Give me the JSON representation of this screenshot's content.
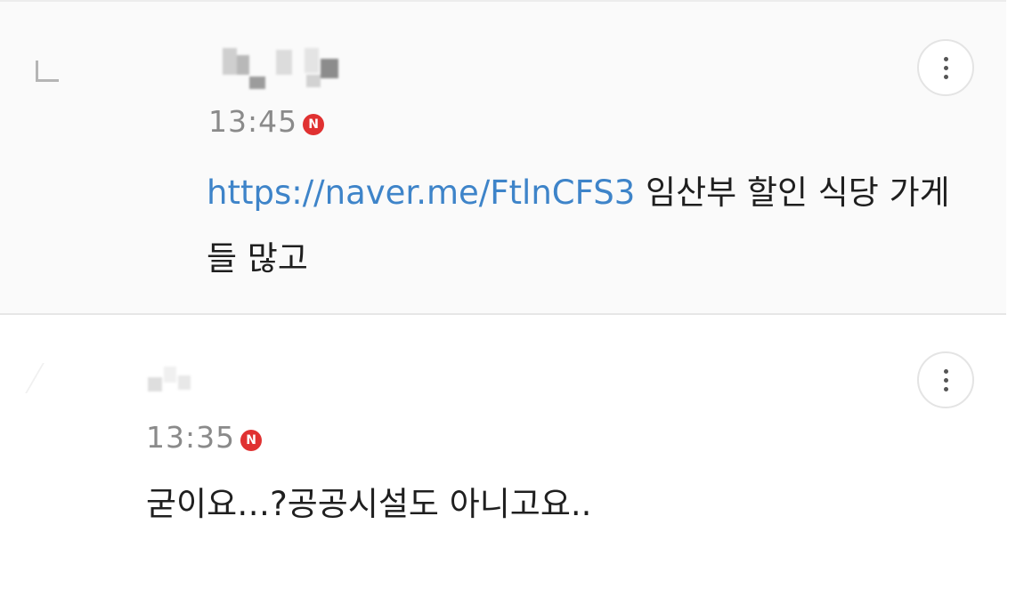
{
  "comments": [
    {
      "type": "reply",
      "time": "13:45",
      "badge": "N",
      "link": "https://naver.me/FtlnCFS3",
      "text_after_link": " 임산부 할인 식당 가게들 많고 "
    },
    {
      "type": "comment",
      "time": "13:35",
      "badge": "N",
      "text": "굳이요…?공공시설도 아니고요.."
    }
  ],
  "icons": {
    "reply_indicator": "reply-arrow-icon",
    "more": "more-vertical-icon"
  },
  "colors": {
    "link": "#3e84c9",
    "new_badge": "#e03131",
    "timestamp": "#8a8a8a"
  }
}
